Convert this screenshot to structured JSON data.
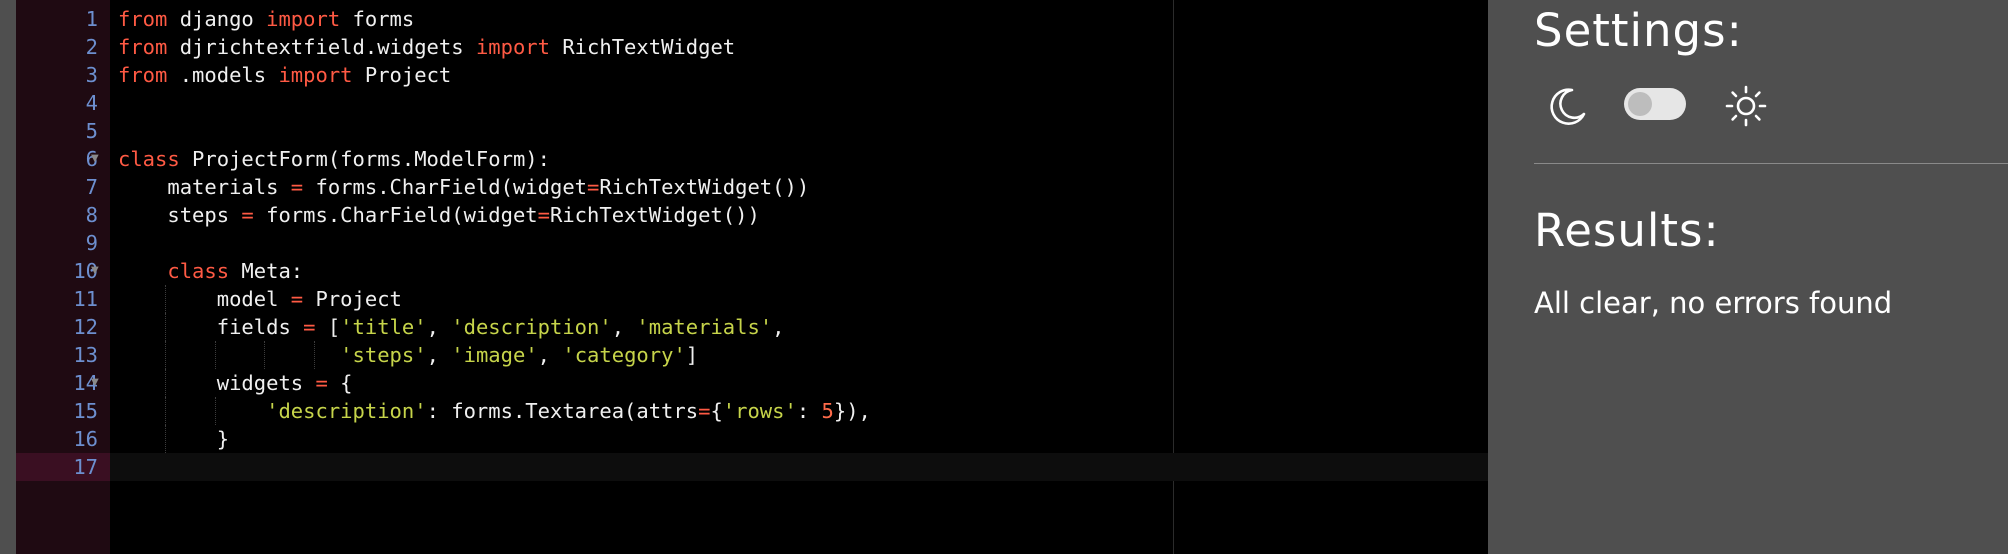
{
  "editor": {
    "lines": [
      {
        "n": "1",
        "tokens": [
          [
            "kw",
            "from"
          ],
          [
            "pl",
            " django "
          ],
          [
            "kw",
            "import"
          ],
          [
            "pl",
            " forms"
          ]
        ]
      },
      {
        "n": "2",
        "tokens": [
          [
            "kw",
            "from"
          ],
          [
            "pl",
            " djrichtextfield.widgets "
          ],
          [
            "kw",
            "import"
          ],
          [
            "pl",
            " RichTextWidget"
          ]
        ]
      },
      {
        "n": "3",
        "tokens": [
          [
            "kw",
            "from"
          ],
          [
            "pl",
            " .models "
          ],
          [
            "kw",
            "import"
          ],
          [
            "pl",
            " Project"
          ]
        ]
      },
      {
        "n": "4",
        "tokens": []
      },
      {
        "n": "5",
        "tokens": []
      },
      {
        "n": "6",
        "fold": true,
        "tokens": [
          [
            "kw",
            "class"
          ],
          [
            "pl",
            " ProjectForm(forms.ModelForm):"
          ]
        ]
      },
      {
        "n": "7",
        "tokens": [
          [
            "pl",
            "    materials "
          ],
          [
            "op",
            "="
          ],
          [
            "pl",
            " forms.CharField(widget"
          ],
          [
            "op",
            "="
          ],
          [
            "pl",
            "RichTextWidget())"
          ]
        ]
      },
      {
        "n": "8",
        "tokens": [
          [
            "pl",
            "    steps "
          ],
          [
            "op",
            "="
          ],
          [
            "pl",
            " forms.CharField(widget"
          ],
          [
            "op",
            "="
          ],
          [
            "pl",
            "RichTextWidget())"
          ]
        ]
      },
      {
        "n": "9",
        "tokens": []
      },
      {
        "n": "10",
        "fold": true,
        "tokens": [
          [
            "pl",
            "    "
          ],
          [
            "kw",
            "class"
          ],
          [
            "pl",
            " Meta:"
          ]
        ]
      },
      {
        "n": "11",
        "guides": [
          1
        ],
        "tokens": [
          [
            "pl",
            "        model "
          ],
          [
            "op",
            "="
          ],
          [
            "pl",
            " Project"
          ]
        ]
      },
      {
        "n": "12",
        "guides": [
          1
        ],
        "tokens": [
          [
            "pl",
            "        fields "
          ],
          [
            "op",
            "="
          ],
          [
            "pl",
            " ["
          ],
          [
            "st",
            "'title'"
          ],
          [
            "pl",
            ", "
          ],
          [
            "st",
            "'description'"
          ],
          [
            "pl",
            ", "
          ],
          [
            "st",
            "'materials'"
          ],
          [
            "pl",
            ","
          ]
        ]
      },
      {
        "n": "13",
        "guides": [
          1,
          2,
          3,
          4
        ],
        "tokens": [
          [
            "pl",
            "                  "
          ],
          [
            "st",
            "'steps'"
          ],
          [
            "pl",
            ", "
          ],
          [
            "st",
            "'image'"
          ],
          [
            "pl",
            ", "
          ],
          [
            "st",
            "'category'"
          ],
          [
            "pl",
            "]"
          ]
        ]
      },
      {
        "n": "14",
        "fold": true,
        "guides": [
          1
        ],
        "tokens": [
          [
            "pl",
            "        widgets "
          ],
          [
            "op",
            "="
          ],
          [
            "pl",
            " {"
          ]
        ]
      },
      {
        "n": "15",
        "guides": [
          1,
          2
        ],
        "tokens": [
          [
            "pl",
            "            "
          ],
          [
            "st",
            "'description'"
          ],
          [
            "pl",
            ": forms.Textarea(attrs"
          ],
          [
            "op",
            "="
          ],
          [
            "pl",
            "{"
          ],
          [
            "st",
            "'rows'"
          ],
          [
            "pl",
            ": "
          ],
          [
            "nu",
            "5"
          ],
          [
            "pl",
            "}),"
          ]
        ]
      },
      {
        "n": "16",
        "guides": [
          1
        ],
        "tokens": [
          [
            "pl",
            "        }"
          ]
        ]
      },
      {
        "n": "17",
        "active": true,
        "tokens": []
      }
    ]
  },
  "settings": {
    "title": "Settings:",
    "moon_icon": "moon-icon",
    "sun_icon": "sun-icon",
    "toggle_state": "off"
  },
  "results": {
    "title": "Results:",
    "message": "All clear, no errors found"
  },
  "colors": {
    "editor_bg": "#000000",
    "gutter_bg": "#1f0a12",
    "panel_bg": "#4f4f4f",
    "keyword": "#ff5a44",
    "string": "#c6d44a",
    "line_number": "#6d8fcf"
  }
}
